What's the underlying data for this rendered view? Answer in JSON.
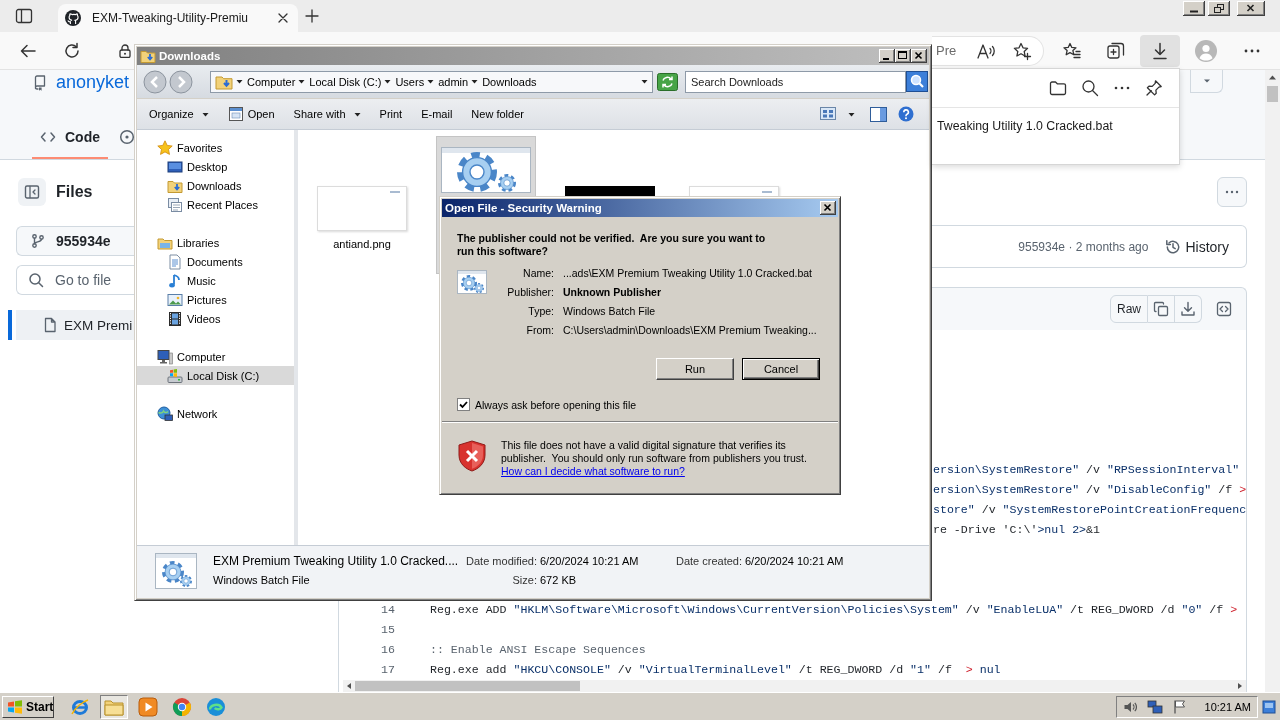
{
  "browser": {
    "tab": {
      "title": "EXM-Tweaking-Utility-Premiu",
      "selected": true
    },
    "address": {
      "text": "Pre"
    },
    "downloads_active": true,
    "downloads_panel": {
      "file_text": "Tweaking Utility 1.0 Cracked.bat"
    }
  },
  "github": {
    "owner": "anonyket",
    "tabs": [
      {
        "kind": "code",
        "label": "Code",
        "selected": true
      },
      {
        "kind": "issues",
        "selected": false
      }
    ],
    "sidebar": {
      "title": "Files",
      "branch": "955934e",
      "search": {
        "placeholder": "Go to file"
      },
      "files": [
        {
          "label": "EXM Premi",
          "selected": true
        }
      ]
    },
    "commit": {
      "text": "955934e · 2 months ago",
      "history": "History"
    },
    "code_toolbar": {
      "raw": "Raw"
    },
    "code": {
      "blocks": [
        {
          "kind": "clipped",
          "lines": [
            {
              "tokens": [
                {
                  "kind": "string",
                  "text": "ersion\\SystemRestore\""
                },
                {
                  "kind": "plain",
                  "text": " /v "
                },
                {
                  "kind": "string",
                  "text": "\"RPSessionInterval\""
                }
              ]
            },
            {
              "tokens": [
                {
                  "kind": "string",
                  "text": "ersion\\SystemRestore\""
                },
                {
                  "kind": "plain",
                  "text": " /v "
                },
                {
                  "kind": "string",
                  "text": "\"DisableConfig\""
                },
                {
                  "kind": "plain",
                  "text": " /f "
                },
                {
                  "kind": "op",
                  "text": ">"
                }
              ]
            },
            {
              "tokens": [
                {
                  "kind": "string",
                  "text": "store\""
                },
                {
                  "kind": "plain",
                  "text": " /v "
                },
                {
                  "kind": "string",
                  "text": "\"SystemRestorePointCreationFrequenc"
                }
              ]
            },
            {
              "tokens": [
                {
                  "kind": "plain",
                  "text": "re -Drive 'C:\\'"
                },
                {
                  "kind": "string",
                  "text": ">nul 2>"
                },
                {
                  "kind": "plain",
                  "text": "&1"
                }
              ]
            }
          ]
        },
        {
          "kind": "full",
          "lines": [
            {
              "number": "14",
              "tokens": [
                {
                  "kind": "plain",
                  "text": "Reg.exe ADD "
                },
                {
                  "kind": "string",
                  "text": "\"HKLM\\Software\\Microsoft\\Windows\\CurrentVersion\\Policies\\System\""
                },
                {
                  "kind": "plain",
                  "text": " /v "
                },
                {
                  "kind": "string",
                  "text": "\"EnableLUA\""
                },
                {
                  "kind": "plain",
                  "text": " /t REG_DWORD /d "
                },
                {
                  "kind": "string",
                  "text": "\"0\""
                },
                {
                  "kind": "plain",
                  "text": " /f "
                },
                {
                  "kind": "op",
                  "text": ">"
                }
              ]
            },
            {
              "number": "15"
            },
            {
              "number": "16",
              "tokens": [
                {
                  "kind": "comment",
                  "text": ":: Enable ANSI Escape Sequences"
                }
              ]
            },
            {
              "number": "17",
              "tokens": [
                {
                  "kind": "plain",
                  "text": "Reg.exe add "
                },
                {
                  "kind": "string",
                  "text": "\"HKCU\\CONSOLE\""
                },
                {
                  "kind": "plain",
                  "text": " /v "
                },
                {
                  "kind": "string",
                  "text": "\"VirtualTerminalLevel\""
                },
                {
                  "kind": "plain",
                  "text": " /t REG_DWORD /d "
                },
                {
                  "kind": "string",
                  "text": "\"1\""
                },
                {
                  "kind": "plain",
                  "text": " /f  "
                },
                {
                  "kind": "op",
                  "text": ">"
                },
                {
                  "kind": "string",
                  "text": " nul"
                }
              ]
            }
          ]
        }
      ]
    }
  },
  "explorer": {
    "title": "Downloads",
    "breadcrumb": [
      "Computer",
      "Local Disk (C:)",
      "Users",
      "admin",
      "Downloads"
    ],
    "search": {
      "placeholder": "Search Downloads"
    },
    "toolbar": [
      {
        "label": "Organize",
        "kind": "menu"
      },
      {
        "label": "Open",
        "kind": "icon"
      },
      {
        "label": "Share with",
        "kind": "menu"
      },
      {
        "label": "Print",
        "kind": "plain"
      },
      {
        "label": "E-mail",
        "kind": "plain"
      },
      {
        "label": "New folder",
        "kind": "plain"
      }
    ],
    "nav": [
      {
        "label": "Favorites",
        "kind": "favorites",
        "selected": false,
        "children": [
          {
            "label": "Desktop",
            "kind": "desktop",
            "selected": false
          },
          {
            "label": "Downloads",
            "kind": "downloads",
            "selected": false
          },
          {
            "label": "Recent Places",
            "kind": "recent",
            "selected": false
          }
        ]
      },
      {
        "label": "Libraries",
        "kind": "libraries",
        "selected": false,
        "children": [
          {
            "label": "Documents",
            "kind": "documents",
            "selected": false
          },
          {
            "label": "Music",
            "kind": "music",
            "selected": false
          },
          {
            "label": "Pictures",
            "kind": "pictures",
            "selected": false
          },
          {
            "label": "Videos",
            "kind": "videos",
            "selected": false
          }
        ]
      },
      {
        "label": "Computer",
        "kind": "computer",
        "selected": false,
        "children": [
          {
            "label": "Local Disk (C:)",
            "kind": "drive",
            "selected": true
          }
        ]
      },
      {
        "label": "Network",
        "kind": "network",
        "selected": false
      }
    ],
    "files": [
      {
        "name": "antiand.png",
        "kind": "blank",
        "selected": false
      },
      {
        "kind": "batch",
        "selected": true
      },
      {
        "kind": "dark",
        "selected": false
      },
      {
        "kind": "blank",
        "selected": false
      }
    ],
    "details": {
      "name": "EXM Premium Tweaking Utility 1.0 Cracked....",
      "type": "Windows Batch File",
      "properties": [
        {
          "label": "Date modified:",
          "value": "6/20/2024 10:21 AM"
        },
        {
          "label": "Size:",
          "value": "672 KB"
        },
        {
          "label": "Date created:",
          "value": "6/20/2024 10:21 AM"
        }
      ]
    }
  },
  "dialog": {
    "title": "Open File - Security Warning",
    "heading": "The publisher could not be verified.  Are you sure you want to run this software?",
    "fields": [
      {
        "label": "Name:",
        "value": "...ads\\EXM Premium Tweaking Utility 1.0 Cracked.bat",
        "strong": false
      },
      {
        "label": "Publisher:",
        "value": "Unknown Publisher",
        "strong": true
      },
      {
        "label": "Type:",
        "value": "Windows Batch File",
        "strong": false
      },
      {
        "label": "From:",
        "value": "C:\\Users\\admin\\Downloads\\EXM Premium Tweaking...",
        "strong": false
      }
    ],
    "buttons": [
      {
        "label": "Run",
        "default": false
      },
      {
        "label": "Cancel",
        "default": true
      }
    ],
    "checkbox": {
      "label": "Always ask before opening this file",
      "checked": true
    },
    "warning": {
      "text": "This file does not have a valid digital signature that verifies its publisher.  You should only run software from publishers you trust.",
      "link": "How can I decide what software to run?"
    }
  },
  "taskbar": {
    "start": "Start",
    "apps": [
      {
        "kind": "ie",
        "selected": false
      },
      {
        "kind": "explorer",
        "selected": true
      },
      {
        "kind": "media",
        "selected": false
      },
      {
        "kind": "chrome",
        "selected": false
      },
      {
        "kind": "edge",
        "selected": false
      }
    ],
    "clock": "10:21 AM"
  }
}
